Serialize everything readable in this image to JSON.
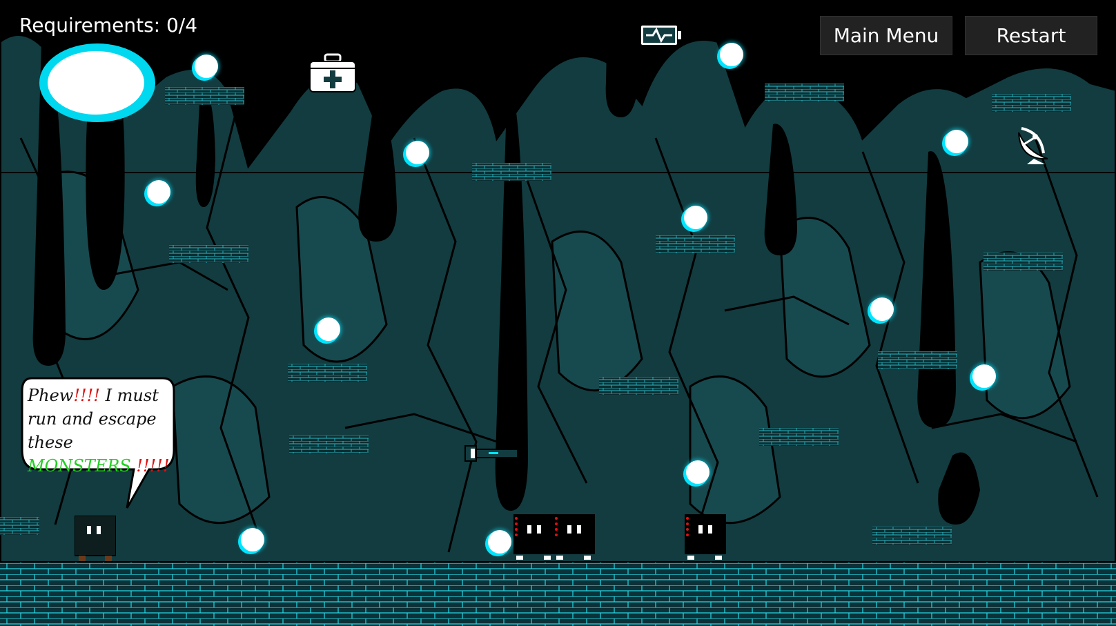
{
  "hud": {
    "requirements_text": "Requirements: 0/4"
  },
  "buttons": {
    "main_menu": "Main Menu",
    "restart": "Restart"
  },
  "speech": {
    "part1": "Phew",
    "part1_exclaim": "!!!!",
    "part2": " I must run and escape these ",
    "monsters": "MONSTERS",
    "part3_exclaim": " !!!!!"
  },
  "items": {
    "medkit": "medkit-icon",
    "battery": "battery-icon",
    "satellite": "satellite-dish-icon",
    "flashlight": "flashlight-icon"
  },
  "colors": {
    "accent": "#00e5ff",
    "rock": "#123c40",
    "floor_brick": "#0a3238",
    "brick_line": "#26d8e6",
    "exclaim": "#e01010",
    "monsters_text": "#22d022",
    "button_bg": "#222222"
  }
}
